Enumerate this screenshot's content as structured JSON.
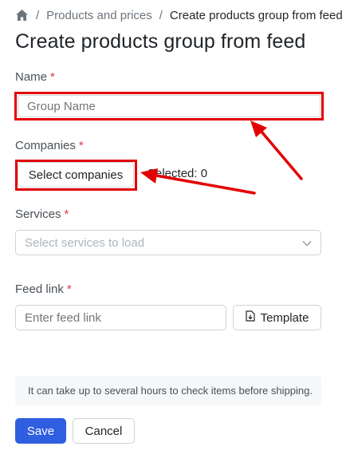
{
  "breadcrumb": {
    "home_icon": "home-icon",
    "separator": "/",
    "items": [
      "Products and prices",
      "Create products group from feed"
    ]
  },
  "page": {
    "title": "Create products group from feed"
  },
  "form": {
    "name": {
      "label": "Name",
      "required_mark": "*",
      "placeholder": "Group Name"
    },
    "companies": {
      "label": "Companies",
      "required_mark": "*",
      "button_label": "Select companies",
      "selected_text": "Selected: 0"
    },
    "services": {
      "label": "Services",
      "required_mark": "*",
      "placeholder": "Select services to load",
      "chevron_icon": "chevron-down-icon"
    },
    "feed_link": {
      "label": "Feed link",
      "required_mark": "*",
      "placeholder": "Enter feed link",
      "template_button": "Template",
      "template_icon": "file-download-icon"
    }
  },
  "notice": {
    "text": "It can take up to several hours to check items before shipping."
  },
  "actions": {
    "save": "Save",
    "cancel": "Cancel"
  },
  "colors": {
    "annotation": "#e30000",
    "primary": "#2f5fe0",
    "required": "#dc3545"
  }
}
